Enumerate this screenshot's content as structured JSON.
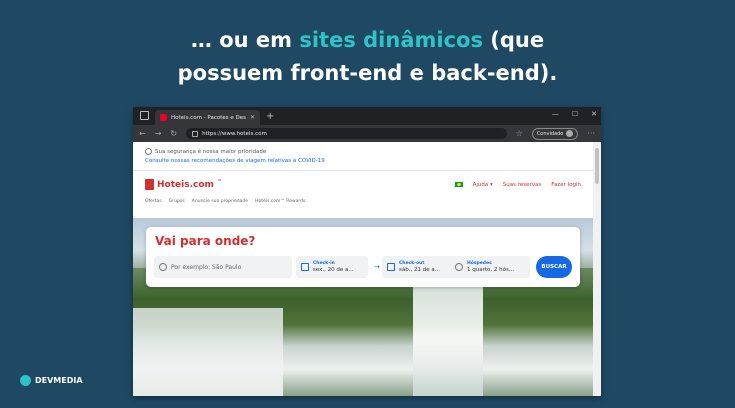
{
  "slide": {
    "headline_prefix": "… ou em ",
    "headline_accent": "sites dinâmicos",
    "headline_suffix": " (que",
    "headline_line2": "possuem front-end e back-end).",
    "logo_text": "DEVMEDIA",
    "accent_color": "#2ec4c7",
    "background_color": "#1f4963"
  },
  "browser": {
    "tab_title": "Hoteis.com - Pacotes e Descontos",
    "new_tab_symbol": "+",
    "window_controls": [
      "—",
      "☐",
      "✕"
    ],
    "url": "https://www.hoteis.com",
    "profile_label": "Convidado",
    "menu_symbol": "···"
  },
  "site": {
    "notice_line1": "Sua segurança é nossa maior prioridade",
    "notice_line2": "Consulte nossas recomendações de viagem relativas à COVID-19",
    "brand": "Hoteis.com",
    "brand_mark": "™",
    "help_label": "Ajuda ▾",
    "reservations_label": "Suas reservas",
    "login_label": "Fazer login",
    "sub_nav": [
      "Ofertas",
      "Grupos",
      "Anuncie sua propriedade",
      "Hotéis.com™ Rewards"
    ],
    "search": {
      "question": "Vai para onde?",
      "destination_placeholder": "Por exemplo: São Paulo",
      "checkin_label": "Check-in",
      "checkin_value": "sex., 20 de a...",
      "checkout_label": "Check-out",
      "checkout_value": "sáb., 21 de a...",
      "guests_label": "Hóspedes",
      "guests_value": "1 quarto, 2 hós...",
      "button_label": "BUSCAR"
    }
  }
}
